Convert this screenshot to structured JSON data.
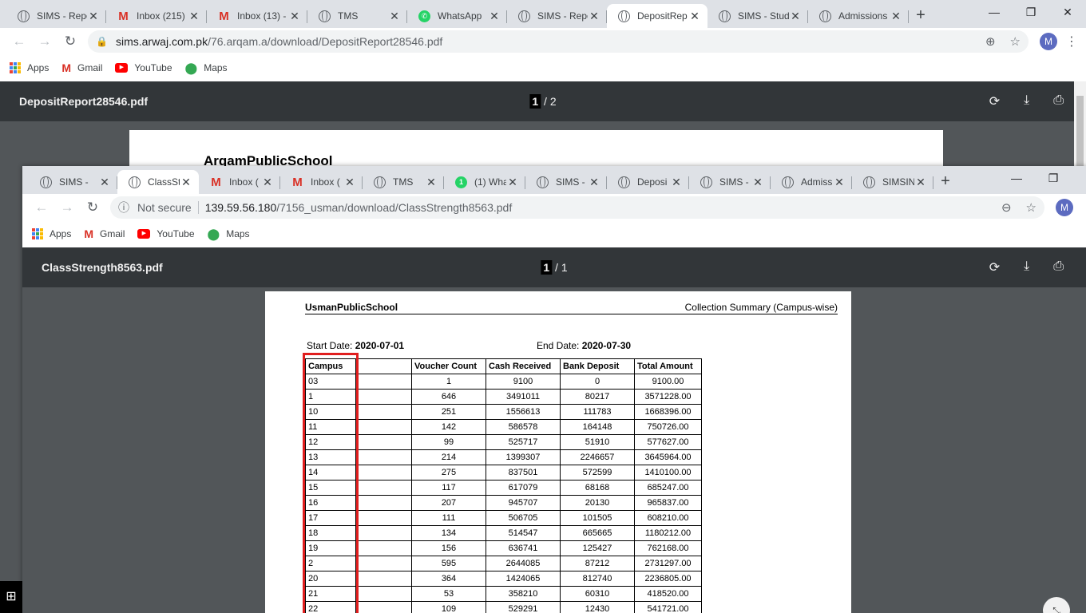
{
  "back_window": {
    "tabs": [
      {
        "icon": "globe",
        "label": "SIMS - Repo",
        "w": 125
      },
      {
        "icon": "gmail",
        "label": "Inbox (215)",
        "w": 126
      },
      {
        "icon": "gmail",
        "label": "Inbox (13) -",
        "w": 126
      },
      {
        "icon": "globe",
        "label": "TMS",
        "w": 125
      },
      {
        "icon": "whatsapp",
        "label": "WhatsApp",
        "w": 125
      },
      {
        "icon": "globe",
        "label": "SIMS - Repo",
        "w": 125
      },
      {
        "icon": "globe",
        "label": "DepositRep",
        "w": 126,
        "active": true
      },
      {
        "icon": "globe",
        "label": "SIMS - Stud",
        "w": 126
      },
      {
        "icon": "globe",
        "label": "Admissions",
        "w": 126
      }
    ],
    "url_host": "sims.arwaj.com.pk",
    "url_path": "/76.arqam.a/download/DepositReport28546.pdf",
    "pdf_title": "DepositReport28546.pdf",
    "page_current": "1",
    "page_total": "/ 2",
    "doc_heading": "ArqamPublicSchool"
  },
  "bookmarks": {
    "apps": "Apps",
    "gmail": "Gmail",
    "youtube": "YouTube",
    "maps": "Maps"
  },
  "avatar_letter": "M",
  "front_window": {
    "tabs": [
      {
        "icon": "globe",
        "label": "SIMS -",
        "w": 111
      },
      {
        "icon": "globe",
        "label": "ClassSt",
        "w": 102,
        "active": true
      },
      {
        "icon": "gmail",
        "label": "Inbox (",
        "w": 102
      },
      {
        "icon": "gmail",
        "label": "Inbox (",
        "w": 103
      },
      {
        "icon": "globe",
        "label": "TMS",
        "w": 102
      },
      {
        "icon": "wa1",
        "label": "(1) Wha",
        "w": 102
      },
      {
        "icon": "globe",
        "label": "SIMS -",
        "w": 102
      },
      {
        "icon": "globe",
        "label": "Deposi",
        "w": 103
      },
      {
        "icon": "globe",
        "label": "SIMS -",
        "w": 102
      },
      {
        "icon": "globe",
        "label": "Admiss",
        "w": 102
      },
      {
        "icon": "globe",
        "label": "SIMSIN",
        "w": 102
      }
    ],
    "security": "Not secure",
    "url_host": "139.59.56.180",
    "url_path": "/7156_usman/download/ClassStrength8563.pdf",
    "pdf_title": "ClassStrength8563.pdf",
    "page_current": "1",
    "page_total": "/ 1"
  },
  "report": {
    "school": "UsmanPublicSchool",
    "title": "Collection Summary (Campus-wise)",
    "start_label": "Start Date:",
    "start_value": "2020-07-01",
    "end_label": "End Date:",
    "end_value": "2020-07-30",
    "headers": [
      "Campus",
      "",
      "Voucher Count",
      "Cash Received",
      "Bank Deposit",
      "Total Amount"
    ],
    "rows": [
      [
        "03",
        "",
        "1",
        "9100",
        "0",
        "9100.00"
      ],
      [
        "1",
        "",
        "646",
        "3491011",
        "80217",
        "3571228.00"
      ],
      [
        "10",
        "",
        "251",
        "1556613",
        "111783",
        "1668396.00"
      ],
      [
        "11",
        "",
        "142",
        "586578",
        "164148",
        "750726.00"
      ],
      [
        "12",
        "",
        "99",
        "525717",
        "51910",
        "577627.00"
      ],
      [
        "13",
        "",
        "214",
        "1399307",
        "2246657",
        "3645964.00"
      ],
      [
        "14",
        "",
        "275",
        "837501",
        "572599",
        "1410100.00"
      ],
      [
        "15",
        "",
        "117",
        "617079",
        "68168",
        "685247.00"
      ],
      [
        "16",
        "",
        "207",
        "945707",
        "20130",
        "965837.00"
      ],
      [
        "17",
        "",
        "111",
        "506705",
        "101505",
        "608210.00"
      ],
      [
        "18",
        "",
        "134",
        "514547",
        "665665",
        "1180212.00"
      ],
      [
        "19",
        "",
        "156",
        "636741",
        "125427",
        "762168.00"
      ],
      [
        "2",
        "",
        "595",
        "2644085",
        "87212",
        "2731297.00"
      ],
      [
        "20",
        "",
        "364",
        "1424065",
        "812740",
        "2236805.00"
      ],
      [
        "21",
        "",
        "53",
        "358210",
        "60310",
        "418520.00"
      ],
      [
        "22",
        "",
        "109",
        "529291",
        "12430",
        "541721.00"
      ]
    ]
  }
}
